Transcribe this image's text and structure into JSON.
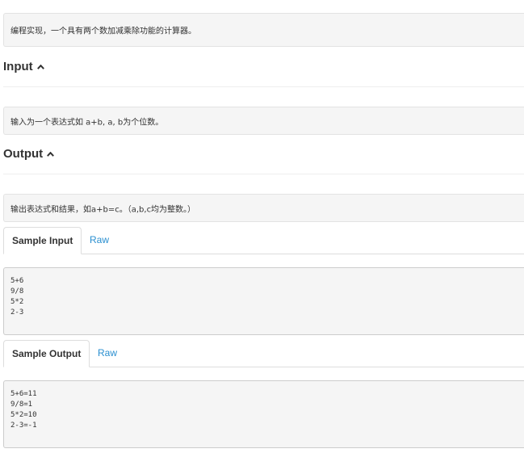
{
  "description": {
    "text": "编程实现，一个具有两个数加减乘除功能的计算器。"
  },
  "input_section": {
    "heading": "Input",
    "text": "输入为一个表达式如 a+b, a, b为个位数。"
  },
  "output_section": {
    "heading": "Output",
    "text": "输出表达式和结果，如a+b=c。（a,b,c均为整数。）"
  },
  "sample_input": {
    "tab_label": "Sample Input",
    "raw_label": "Raw",
    "lines": [
      "5+6",
      "9/8",
      "5*2",
      "2-3"
    ]
  },
  "sample_output": {
    "tab_label": "Sample Output",
    "raw_label": "Raw",
    "lines": [
      "5+6=11",
      "9/8=1",
      "5*2=10",
      "2-3=-1"
    ]
  },
  "icons": {
    "collapse": "caret-up-icon"
  },
  "colors": {
    "link": "#2a8fd0",
    "box_background": "#f5f5f5"
  }
}
